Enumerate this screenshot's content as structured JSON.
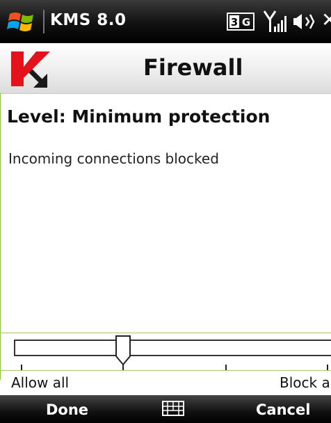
{
  "status_bar": {
    "app_title": "KMS 8.0",
    "icons": [
      "windows-start-icon",
      "3g-icon",
      "signal-strength-icon",
      "volume-icon",
      "close-icon"
    ],
    "close_glyph": "✕"
  },
  "header": {
    "title": "Firewall",
    "logo": "kaspersky-logo-icon",
    "brand_colors": {
      "red": "#e3121b",
      "arrow": "#1a1a1a"
    }
  },
  "content": {
    "level_title": "Level: Minimum protection",
    "description": "Incoming connections blocked"
  },
  "slider": {
    "min_label": "Allow all",
    "max_label": "Block a",
    "position_fraction": 0.33,
    "accent_line_color": "#9ccc65"
  },
  "softkeys": {
    "left": "Done",
    "center_icon": "keyboard-icon",
    "right": "Cancel"
  }
}
